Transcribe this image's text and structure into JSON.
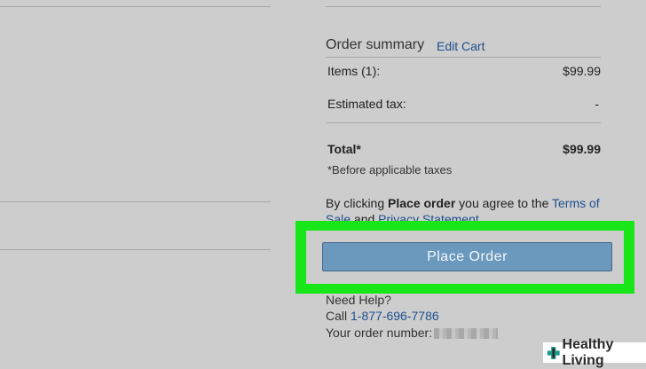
{
  "summary": {
    "title": "Order summary",
    "edit_cart": "Edit Cart",
    "items_label": "Items (1):",
    "items_value": "$99.99",
    "tax_label": "Estimated tax:",
    "tax_value": "-",
    "total_label": "Total*",
    "total_value": "$99.99",
    "note": "*Before applicable taxes"
  },
  "agreement": {
    "prefix": "By clicking ",
    "bold": "Place order",
    "middle": " you agree to the ",
    "terms_link": "Terms of",
    "terms_link_cont": "Sale",
    "and": " and ",
    "privacy_link": "Privacy Statement"
  },
  "place_order_button": "Place Order",
  "help": {
    "title": "Need Help?",
    "call_prefix": "Call ",
    "phone": "1-877-696-7786",
    "order_number_label": "Your order number:"
  },
  "watermark": {
    "text": "Healthy Living"
  },
  "colors": {
    "highlight": "#19e619",
    "button": "#6b99bd",
    "link": "#1d4f8f"
  }
}
